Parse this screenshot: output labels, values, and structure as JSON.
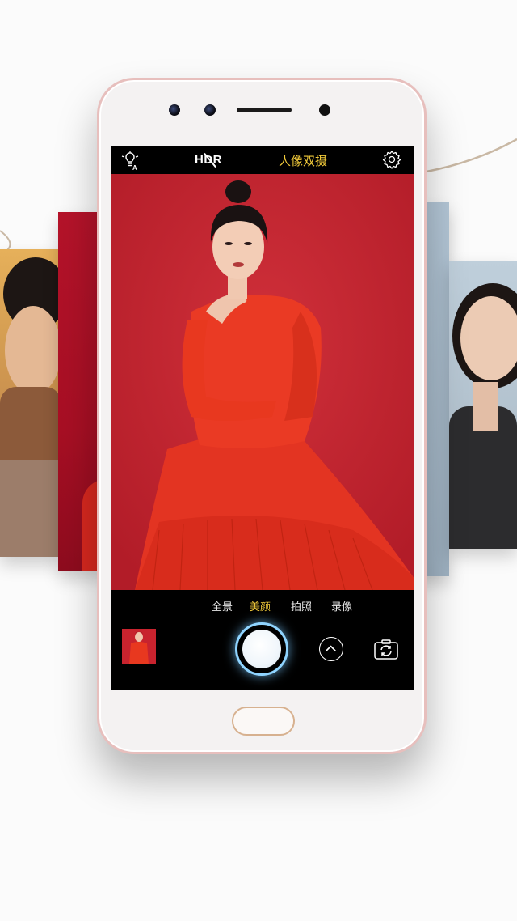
{
  "camera_app": {
    "top_bar": {
      "flash_icon": "bulb-auto-flash-icon",
      "hdr_label": "HDR",
      "hdr_state": "off",
      "mode_title": "人像双摄",
      "settings_icon": "gear-icon"
    },
    "mode_tabs": [
      {
        "label": "全景",
        "active": false
      },
      {
        "label": "美颜",
        "active": true
      },
      {
        "label": "拍照",
        "active": false
      },
      {
        "label": "录像",
        "active": false
      }
    ],
    "controls": {
      "gallery_thumbnail": "gallery-thumbnail",
      "shutter": "shutter-button",
      "expand": "chevron-up-icon",
      "switch_camera": "camera-switch-icon"
    }
  },
  "colors": {
    "accent_yellow": "#f0c93a",
    "viewfinder_red": "#c8232e",
    "dress_red": "#e8321f",
    "shutter_glow": "#8fd4ff",
    "phone_frame_rose": "#e7bfbd"
  }
}
